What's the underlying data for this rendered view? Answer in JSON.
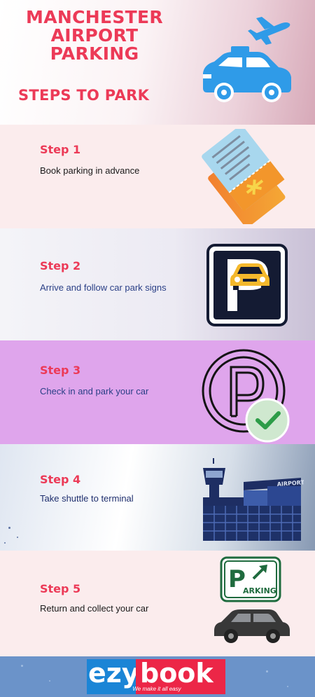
{
  "header": {
    "title_lines": [
      "MANCHESTER",
      "AIRPORT",
      "PARKING"
    ],
    "subtitle": "STEPS TO PARK",
    "icon": "airport-taxi-icon"
  },
  "steps": [
    {
      "title": "Step 1",
      "text": "Book parking in advance",
      "icon": "boarding-pass-icon"
    },
    {
      "title": "Step 2",
      "text": "Arrive and follow car park signs",
      "icon": "parking-car-sign-icon"
    },
    {
      "title": "Step 3",
      "text": "Check in and park your car",
      "icon": "parking-check-icon"
    },
    {
      "title": "Step 4",
      "text": "Take shuttle to terminal",
      "icon": "airport-terminal-icon",
      "building_label": "AIRPORT"
    },
    {
      "title": "Step 5",
      "text": "Return and collect your car",
      "icon": "parking-sign-car-icon",
      "sign_label": "ARKING"
    }
  ],
  "footer": {
    "logo_part1": "ezy",
    "logo_part2": "book",
    "tagline": "We make it all easy"
  },
  "colors": {
    "accent": "#ec3a57",
    "step_text_blue": "#2a3f86",
    "logo_blue": "#1b85d6",
    "logo_red": "#ec2647"
  }
}
